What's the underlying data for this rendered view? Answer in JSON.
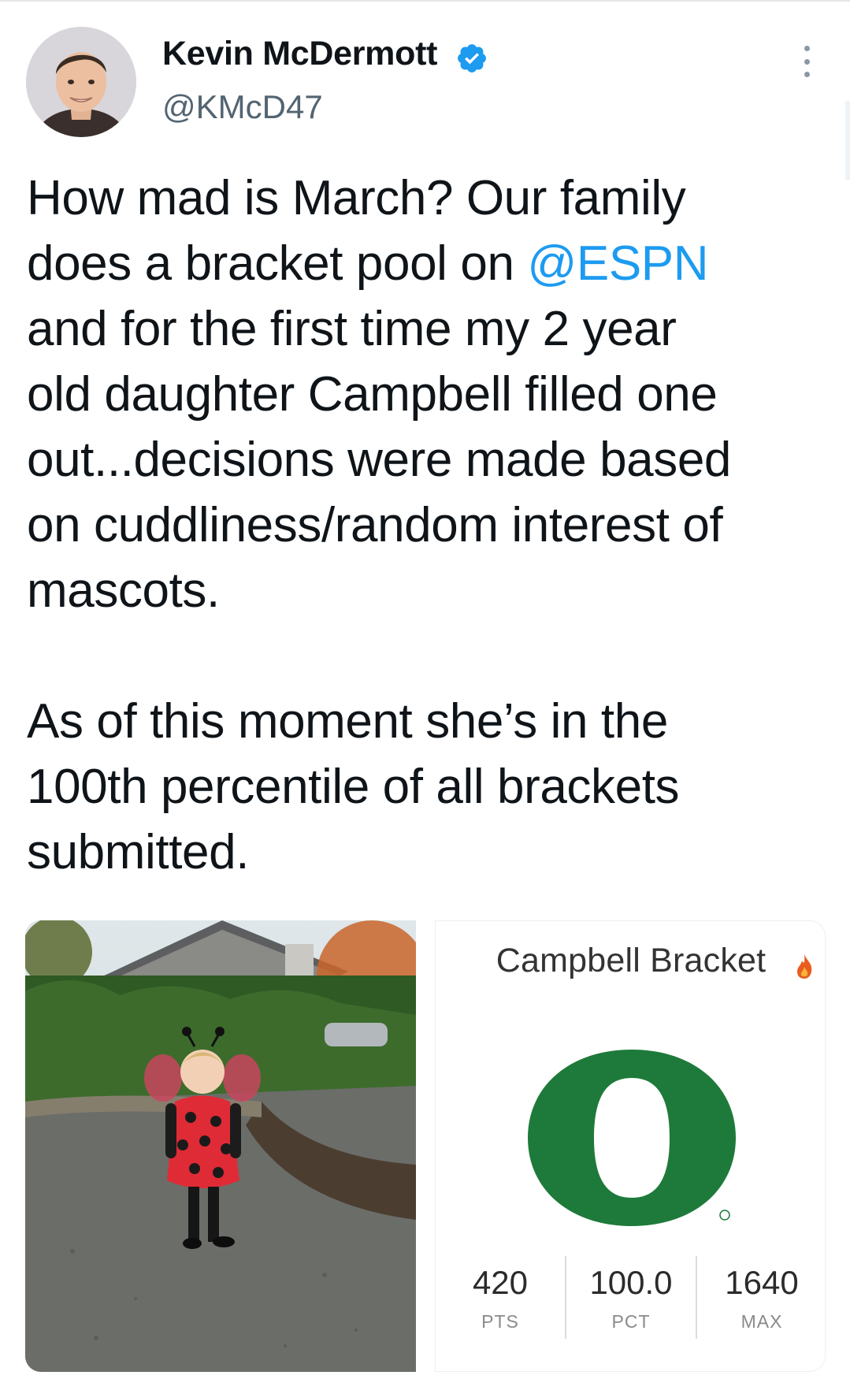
{
  "author": {
    "display_name": "Kevin McDermott",
    "handle": "@KMcD47",
    "verified": true
  },
  "tweet": {
    "paragraph1_lines": [
      {
        "text": "How mad is March? Our family"
      },
      {
        "text": "does a bracket pool on ",
        "mention": "@ESPN"
      },
      {
        "text": "and for the first time my 2 year"
      },
      {
        "text": "old daughter Campbell filled one"
      },
      {
        "text": "out...decisions were made based"
      },
      {
        "text": "on cuddliness/random interest of"
      },
      {
        "text": "mascots."
      }
    ],
    "paragraph2_lines": [
      {
        "text": "As of this moment she’s in the"
      },
      {
        "text": "100th percentile of all brackets"
      },
      {
        "text": "submitted."
      }
    ]
  },
  "bracket_card": {
    "title": "Campbell Bracket",
    "logo_letter": "O",
    "stats": [
      {
        "value": "420",
        "label": "PTS"
      },
      {
        "value": "100.0",
        "label": "PCT"
      },
      {
        "value": "1640",
        "label": "MAX"
      }
    ]
  },
  "colors": {
    "mention": "#1d9bf0",
    "verified_badge": "#1d9bf0",
    "oregon_green": "#1e7a3a",
    "flame": "#e85d1f"
  },
  "icons": [
    "verified-badge-icon",
    "more-options-icon",
    "flame-icon"
  ]
}
